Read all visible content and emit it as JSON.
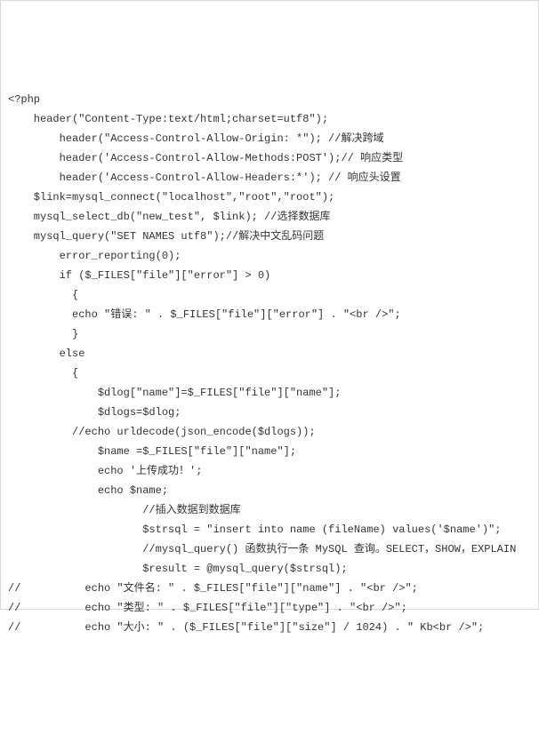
{
  "code": {
    "lines": [
      "<?php",
      "    header(\"Content-Type:text/html;charset=utf8\");",
      "        header(\"Access-Control-Allow-Origin: *\"); //解决跨域",
      "        header('Access-Control-Allow-Methods:POST');// 响应类型",
      "        header('Access-Control-Allow-Headers:*'); // 响应头设置",
      "    $link=mysql_connect(\"localhost\",\"root\",\"root\");",
      "    mysql_select_db(\"new_test\", $link); //选择数据库",
      "    mysql_query(\"SET NAMES utf8\");//解决中文乱码问题",
      "        error_reporting(0);",
      "        if ($_FILES[\"file\"][\"error\"] > 0)",
      "          {",
      "          echo \"错误: \" . $_FILES[\"file\"][\"error\"] . \"<br />\";",
      "          }",
      "        else",
      "          {",
      "              $dlog[\"name\"]=$_FILES[\"file\"][\"name\"];",
      "              $dlogs=$dlog;",
      "          //echo urldecode(json_encode($dlogs));",
      "              $name =$_FILES[\"file\"][\"name\"];",
      "              echo '上传成功！';",
      "              echo $name;",
      "                     //插入数据到数据库",
      "                     $strsql = \"insert into name (fileName) values('$name')\";",
      "                     //mysql_query() 函数执行一条 MySQL 查询。SELECT，SHOW，EXPLAIN",
      "                     $result = @mysql_query($strsql);",
      "//          echo \"文件名: \" . $_FILES[\"file\"][\"name\"] . \"<br />\";",
      "//          echo \"类型: \" . $_FILES[\"file\"][\"type\"] . \"<br />\";",
      "//          echo \"大小: \" . ($_FILES[\"file\"][\"size\"] / 1024) . \" Kb<br />\";"
    ]
  }
}
